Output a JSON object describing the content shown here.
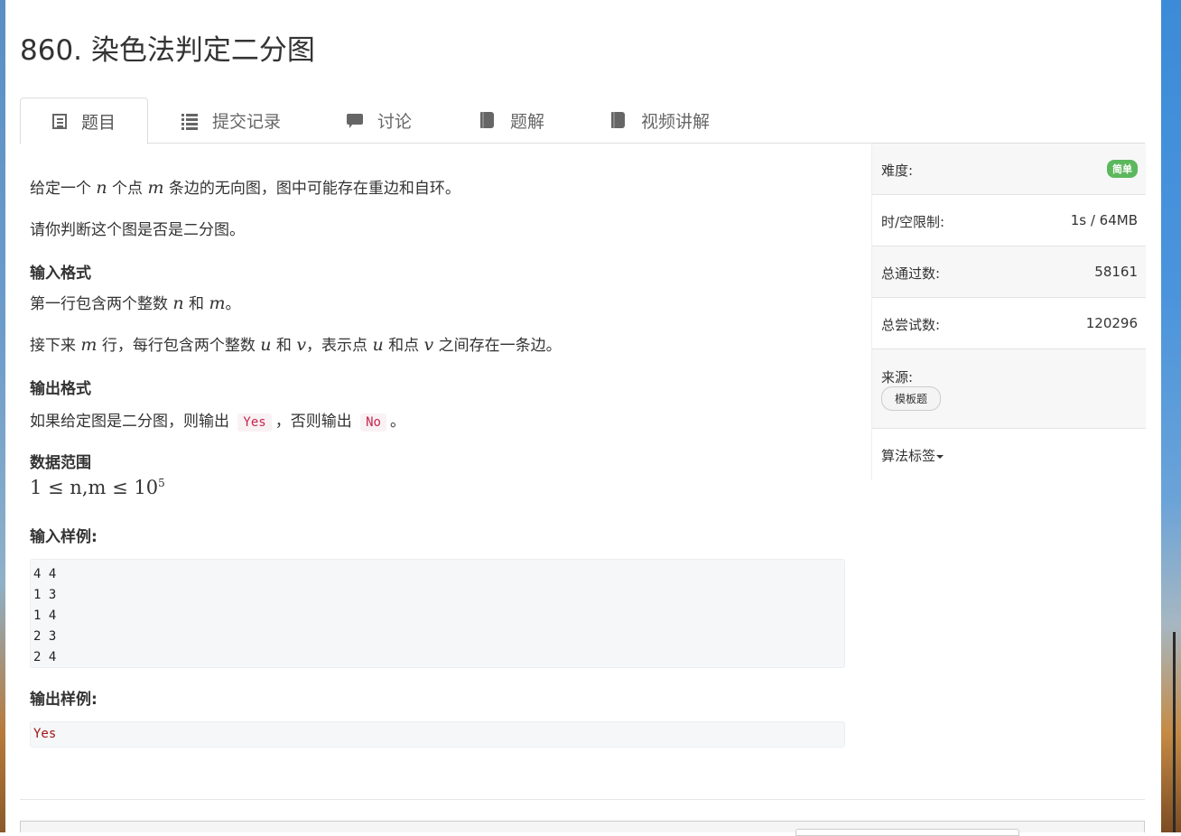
{
  "title": "860. 染色法判定二分图",
  "tabs": [
    {
      "label": "题目",
      "icon": "document-list-icon"
    },
    {
      "label": "提交记录",
      "icon": "list-icon"
    },
    {
      "label": "讨论",
      "icon": "comment-icon"
    },
    {
      "label": "题解",
      "icon": "book-icon"
    },
    {
      "label": "视频讲解",
      "icon": "book-icon"
    }
  ],
  "problem": {
    "p1": {
      "a": "给定一个 ",
      "n": "n",
      "b": " 个点 ",
      "m": "m",
      "c": " 条边的无向图，图中可能存在重边和自环。"
    },
    "p2": "请你判断这个图是否是二分图。",
    "input_heading": "输入格式",
    "input1": {
      "a": "第一行包含两个整数 ",
      "n": "n",
      "b": " 和 ",
      "m": "m",
      "c": "。"
    },
    "input2": {
      "a": "接下来 ",
      "m": "m",
      "b": " 行，每行包含两个整数 ",
      "u": "u",
      "c": " 和 ",
      "v": "v",
      "d": "，表示点 ",
      "u2": "u",
      "e": " 和点 ",
      "v2": "v",
      "f": " 之间存在一条边。"
    },
    "output_heading": "输出格式",
    "output1": {
      "a": "如果给定图是二分图，则输出 ",
      "yes": "Yes",
      "b": "，否则输出 ",
      "no": "No",
      "c": "。"
    },
    "range_heading": "数据范围",
    "range": {
      "text": "1 ≤ n,m ≤ 10",
      "exp": "5"
    },
    "sample_in_heading": "输入样例:",
    "sample_in": "4 4\n1 3\n1 4\n2 3\n2 4",
    "sample_out_heading": "输出样例:",
    "sample_out": "Yes"
  },
  "sidebar": {
    "difficulty_label": "难度:",
    "difficulty_value": "简单",
    "limit_label": "时/空限制:",
    "limit_value": "1s / 64MB",
    "passed_label": "总通过数:",
    "passed_value": "58161",
    "tried_label": "总尝试数:",
    "tried_value": "120296",
    "source_label": "来源:",
    "source_tag": "模板题",
    "tags_label": "算法标签"
  }
}
